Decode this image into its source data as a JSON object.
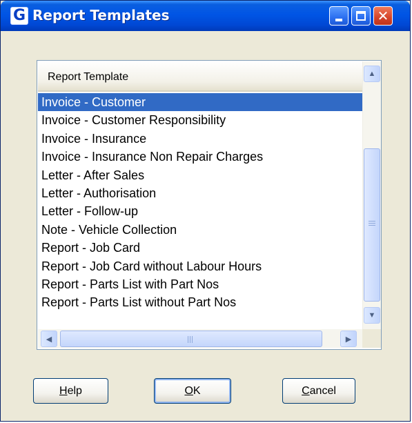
{
  "window": {
    "title": "Report Templates",
    "app_icon_letter": "G",
    "close_glyph": "✕"
  },
  "list": {
    "column_header": "Report Template",
    "selected_index": 0,
    "items": [
      "Invoice - Customer",
      "Invoice - Customer Responsibility",
      "Invoice - Insurance",
      "Invoice - Insurance Non Repair Charges",
      "Letter - After Sales",
      "Letter - Authorisation",
      "Letter - Follow-up",
      "Note - Vehicle Collection",
      "Report - Job Card",
      "Report - Job Card without Labour Hours",
      "Report - Parts List with Part Nos",
      "Report - Parts List without Part Nos"
    ]
  },
  "scrollbar": {
    "up_arrow": "▲",
    "down_arrow": "▼",
    "left_arrow": "◀",
    "right_arrow": "▶"
  },
  "buttons": {
    "help": {
      "accel": "H",
      "rest": "elp"
    },
    "ok": {
      "accel": "O",
      "rest": "K"
    },
    "cancel": {
      "accel": "C",
      "rest": "ancel"
    }
  }
}
